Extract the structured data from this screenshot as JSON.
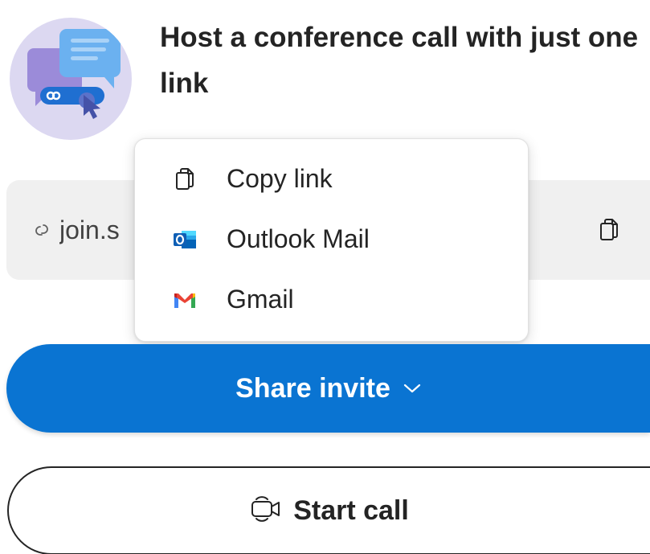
{
  "header": {
    "title": "Host a conference call with just one link"
  },
  "link_field": {
    "value": "join.s",
    "icon": "link-icon",
    "copy_icon": "copy-icon"
  },
  "share_menu": {
    "items": [
      {
        "label": "Copy link",
        "icon": "copy-icon"
      },
      {
        "label": "Outlook Mail",
        "icon": "outlook-icon"
      },
      {
        "label": "Gmail",
        "icon": "gmail-icon"
      }
    ]
  },
  "actions": {
    "share_invite_label": "Share invite",
    "share_invite_icon": "chevron-down-icon",
    "start_call_label": "Start call",
    "start_call_icon": "video-camera-icon"
  },
  "colors": {
    "primary": "#0a74d2",
    "field_background": "#f0f0f0",
    "illustration_background": "#dcd8f1",
    "text": "#242424"
  }
}
